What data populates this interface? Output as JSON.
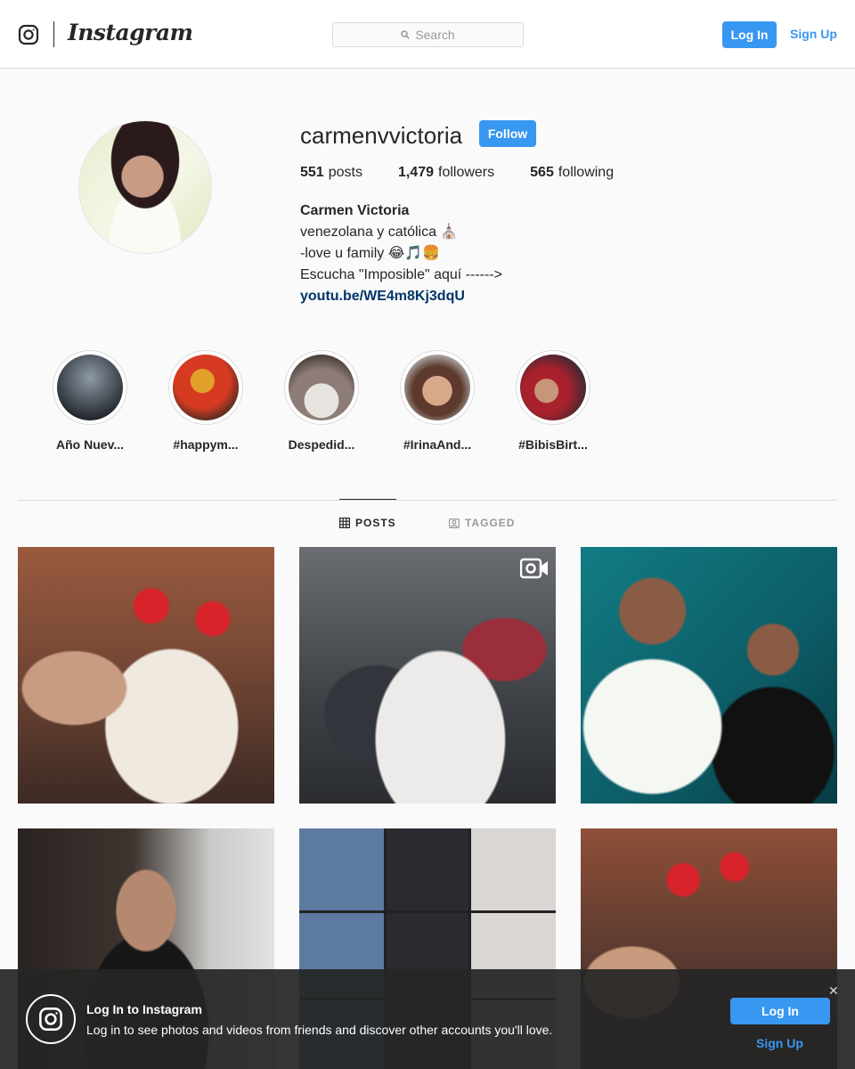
{
  "header": {
    "brand": "Instagram",
    "search_placeholder": "Search",
    "login_label": "Log In",
    "signup_label": "Sign Up"
  },
  "profile": {
    "username": "carmenvvictoria",
    "follow_label": "Follow",
    "stats": {
      "posts_count": "551",
      "posts_label": "posts",
      "followers_count": "1,479",
      "followers_label": "followers",
      "following_count": "565",
      "following_label": "following"
    },
    "bio": {
      "full_name": "Carmen Victoria",
      "line1": "venezolana y católica ⛪",
      "line2": "-love u family 😂🎵🍔",
      "line3": "Escucha \"Imposible\" aquí ------>",
      "url": "youtu.be/WE4m8Kj3dqU"
    }
  },
  "highlights": [
    {
      "label": "Año Nuev...",
      "color_a": "#8e9aa8",
      "color_b": "#1f2328"
    },
    {
      "label": "#happym...",
      "color_a": "#d63b22",
      "color_b": "#3a2a1e"
    },
    {
      "label": "Despedid...",
      "color_a": "#c9c4c0",
      "color_b": "#4b3f3c"
    },
    {
      "label": "#IrinaAnd...",
      "color_a": "#b88668",
      "color_b": "#5d3a2d"
    },
    {
      "label": "#BibisBirt...",
      "color_a": "#a8212d",
      "color_b": "#2e2a33"
    }
  ],
  "tabs": {
    "posts_label": "POSTS",
    "tagged_label": "TAGGED"
  },
  "banner": {
    "title": "Log In to Instagram",
    "text": "Log in to see photos and videos from friends and discover other accounts you'll love.",
    "login_label": "Log In",
    "signup_label": "Sign Up",
    "close_glyph": "✕"
  },
  "colors": {
    "accent": "#3897f0",
    "link": "#003569",
    "text": "#262626",
    "muted": "#999999",
    "border": "#dbdbdb"
  }
}
